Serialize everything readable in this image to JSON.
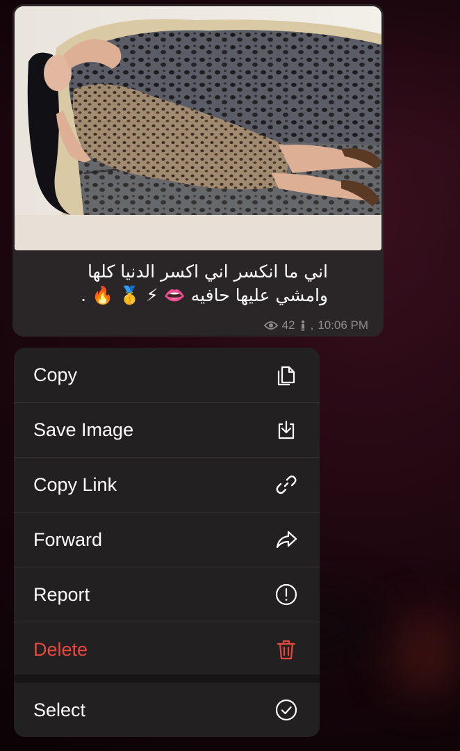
{
  "message": {
    "photo_alt_icon": "photo-icon",
    "caption_lines": [
      "اني ما انكسر اني اكسر الدنيا كلها",
      "وامشي عليها حافيه 👄 ⚡ 🥇 🔥 ."
    ],
    "views": "42",
    "time": "10:06 PM",
    "author_icon": "person-icon",
    "views_icon": "eye-icon"
  },
  "menu": {
    "items": [
      {
        "label": "Copy",
        "icon": "copy-icon"
      },
      {
        "label": "Save Image",
        "icon": "download-icon"
      },
      {
        "label": "Copy Link",
        "icon": "link-icon"
      },
      {
        "label": "Forward",
        "icon": "forward-icon"
      },
      {
        "label": "Report",
        "icon": "alert-icon"
      },
      {
        "label": "Delete",
        "icon": "trash-icon"
      },
      {
        "label": "Select",
        "icon": "check-circle-icon"
      }
    ]
  },
  "colors": {
    "bubble": "#2a2527",
    "menu": "#232021",
    "danger": "#e5483f",
    "meta": "#8f8a8c"
  }
}
